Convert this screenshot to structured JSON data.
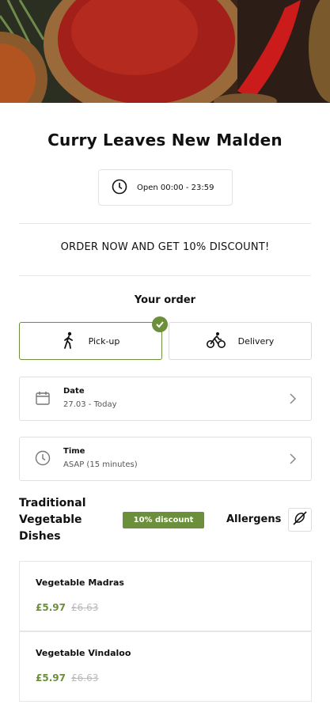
{
  "restaurant": {
    "name": "Curry Leaves New Malden"
  },
  "hours": {
    "text": "Open 00:00 - 23:59"
  },
  "promo": {
    "text": "ORDER NOW AND GET 10% DISCOUNT!"
  },
  "order": {
    "heading": "Your order",
    "modes": [
      {
        "label": "Pick-up",
        "icon": "walking-person-icon",
        "selected": true
      },
      {
        "label": "Delivery",
        "icon": "cyclist-icon",
        "selected": false
      }
    ],
    "date": {
      "label": "Date",
      "value": "27.03 - Today"
    },
    "time": {
      "label": "Time",
      "value": "ASAP (15 minutes)"
    }
  },
  "menu": {
    "section_title": "Traditional Vegetable Dishes",
    "discount_badge": "10% discount",
    "allergens_label": "Allergens",
    "items": [
      {
        "name": "Vegetable Madras",
        "price": "£5.97",
        "old_price": "£6.63"
      },
      {
        "name": "Vegetable Vindaloo",
        "price": "£5.97",
        "old_price": "£6.63"
      }
    ]
  },
  "colors": {
    "accent": "#6b8f3a",
    "border": "#e0e0e0"
  }
}
